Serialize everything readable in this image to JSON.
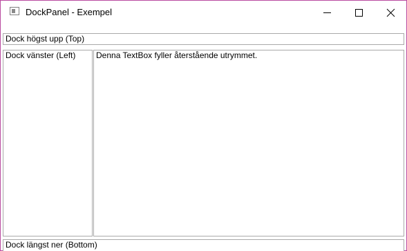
{
  "window": {
    "title": "DockPanel - Exempel",
    "icon": "window-app-icon"
  },
  "caption_buttons": {
    "minimize": "minimize-icon",
    "maximize": "maximize-icon",
    "close": "close-icon"
  },
  "dock_panel": {
    "top_text": "Dock högst upp (Top)",
    "left_text": "Dock vänster (Left)",
    "fill_text": "Denna TextBox fyller återstående utrymmet.",
    "bottom_text": "Dock längst ner (Bottom)"
  }
}
